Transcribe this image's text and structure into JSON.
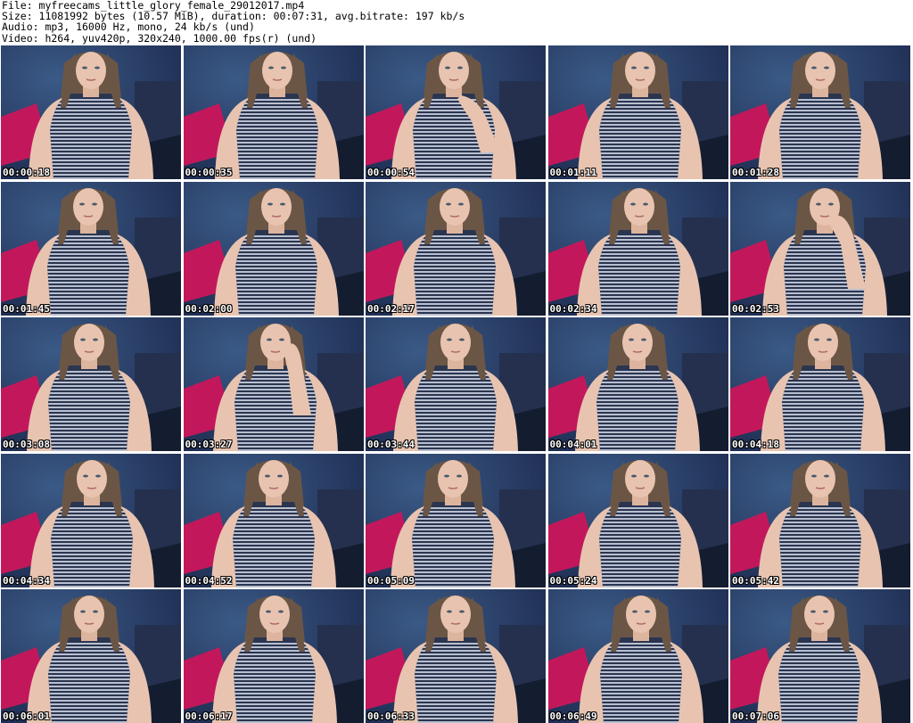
{
  "info": {
    "file": "File: myfreecams_little_glory_female_29012017.mp4",
    "size": "Size: 11081992 bytes (10.57 MiB), duration: 00:07:31, avg.bitrate: 197 kb/s",
    "audio": "Audio: mp3, 16000 Hz, mono, 24 kb/s (und)",
    "video": "Video: h264, yuv420p, 320x240, 1000.00 fps(r) (und)"
  },
  "thumbnails": [
    {
      "timestamp": "00:00:18",
      "pose": "neutral"
    },
    {
      "timestamp": "00:00:35",
      "pose": "neutral"
    },
    {
      "timestamp": "00:00:54",
      "pose": "hand-chin"
    },
    {
      "timestamp": "00:01:11",
      "pose": "neutral"
    },
    {
      "timestamp": "00:01:28",
      "pose": "neutral"
    },
    {
      "timestamp": "00:01:45",
      "pose": "neutral"
    },
    {
      "timestamp": "00:02:00",
      "pose": "neutral"
    },
    {
      "timestamp": "00:02:17",
      "pose": "neutral"
    },
    {
      "timestamp": "00:02:34",
      "pose": "neutral"
    },
    {
      "timestamp": "00:02:53",
      "pose": "hand-mouth"
    },
    {
      "timestamp": "00:03:08",
      "pose": "neutral"
    },
    {
      "timestamp": "00:03:27",
      "pose": "hand-cheek"
    },
    {
      "timestamp": "00:03:44",
      "pose": "neutral"
    },
    {
      "timestamp": "00:04:01",
      "pose": "neutral"
    },
    {
      "timestamp": "00:04:18",
      "pose": "neutral"
    },
    {
      "timestamp": "00:04:34",
      "pose": "neutral"
    },
    {
      "timestamp": "00:04:52",
      "pose": "neutral"
    },
    {
      "timestamp": "00:05:09",
      "pose": "neutral"
    },
    {
      "timestamp": "00:05:24",
      "pose": "neutral"
    },
    {
      "timestamp": "00:05:42",
      "pose": "neutral"
    },
    {
      "timestamp": "00:06:01",
      "pose": "neutral"
    },
    {
      "timestamp": "00:06:17",
      "pose": "neutral"
    },
    {
      "timestamp": "00:06:33",
      "pose": "neutral"
    },
    {
      "timestamp": "00:06:49",
      "pose": "neutral"
    },
    {
      "timestamp": "00:07:06",
      "pose": "neutral"
    }
  ],
  "colors": {
    "background_wall": "#1f2d52",
    "pillow": "#c2185b",
    "skin": "#e8c4b0",
    "hair": "#6b5646",
    "top_stripe_dark": "#2a3550",
    "top_stripe_light": "#b9bfcf"
  }
}
